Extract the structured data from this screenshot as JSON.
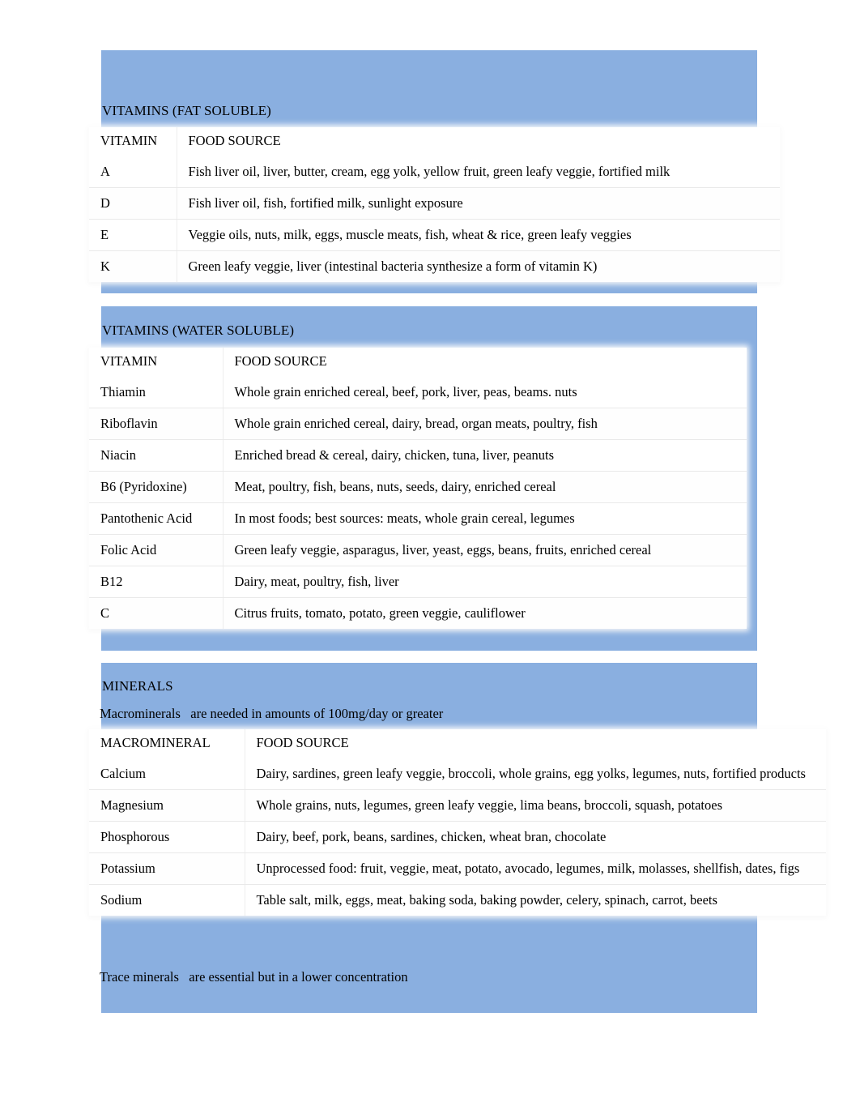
{
  "document": {
    "background_color": "#ffffff",
    "band_color": "#8AAFE0"
  },
  "sections": [
    {
      "id": "fat-soluble",
      "heading": "VITAMINS (FAT SOLUBLE)",
      "table": {
        "headers": [
          "VITAMIN",
          "FOOD SOURCE"
        ],
        "rows": [
          [
            "A",
            "Fish liver oil, liver, butter, cream, egg yolk, yellow fruit, green leafy veggie, fortified milk"
          ],
          [
            "D",
            "Fish liver oil, fish, fortified milk, sunlight exposure"
          ],
          [
            "E",
            "Veggie oils, nuts, milk, eggs, muscle meats, fish, wheat & rice, green leafy veggies"
          ],
          [
            "K",
            "Green leafy veggie, liver (intestinal bacteria synthesize a form of vitamin K)"
          ]
        ]
      }
    },
    {
      "id": "water-soluble",
      "heading": "VITAMINS (WATER SOLUBLE)",
      "table": {
        "headers": [
          "VITAMIN",
          "FOOD SOURCE"
        ],
        "rows": [
          [
            "Thiamin",
            "Whole grain enriched cereal, beef, pork, liver, peas, beams. nuts"
          ],
          [
            "Riboflavin",
            "Whole grain enriched cereal, dairy, bread, organ meats, poultry, fish"
          ],
          [
            "Niacin",
            "Enriched bread & cereal, dairy, chicken, tuna, liver, peanuts"
          ],
          [
            "B6 (Pyridoxine)",
            "Meat, poultry, fish, beans, nuts, seeds, dairy, enriched cereal"
          ],
          [
            "Pantothenic Acid",
            "In most foods; best sources: meats, whole grain cereal, legumes"
          ],
          [
            "Folic Acid",
            "Green leafy veggie, asparagus, liver, yeast, eggs, beans, fruits, enriched cereal"
          ],
          [
            "B12",
            "Dairy, meat, poultry, fish, liver"
          ],
          [
            "C",
            "Citrus fruits, tomato, potato, green veggie, cauliflower"
          ]
        ]
      }
    },
    {
      "id": "minerals",
      "heading": "MINERALS",
      "note_above": "Macrominerals   are needed in amounts of 100mg/day or greater",
      "note_below": "Trace minerals   are essential but in a lower concentration",
      "table": {
        "headers": [
          "MACROMINERAL",
          "FOOD SOURCE"
        ],
        "rows": [
          [
            "Calcium",
            "Dairy, sardines, green leafy veggie, broccoli, whole grains, egg yolks, legumes, nuts, fortified products"
          ],
          [
            "Magnesium",
            "Whole grains, nuts, legumes, green leafy veggie, lima beans, broccoli, squash, potatoes"
          ],
          [
            "Phosphorous",
            "Dairy, beef, pork, beans, sardines, chicken, wheat bran, chocolate"
          ],
          [
            "Potassium",
            "Unprocessed food: fruit, veggie, meat, potato, avocado, legumes, milk, molasses, shellfish, dates, figs"
          ],
          [
            "Sodium",
            "Table salt, milk, eggs, meat, baking soda, baking powder, celery, spinach, carrot, beets"
          ]
        ]
      }
    }
  ]
}
